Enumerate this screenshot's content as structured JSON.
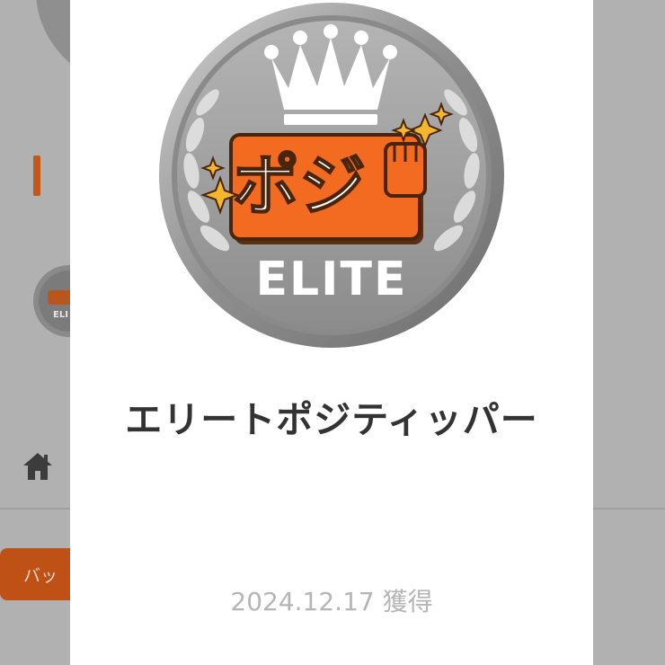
{
  "background": {
    "tab_button_label": "バッ",
    "home_icon": "home-icon"
  },
  "modal": {
    "badge": {
      "logo_text": "ポジ",
      "elite_text": "ELITE",
      "icons": [
        "crown-icon",
        "laurel-icon",
        "sparkle-icon",
        "fist-icon"
      ]
    },
    "title": "エリートポジティッパー",
    "date_acquired": "2024.12.17 獲得"
  },
  "colors": {
    "accent_orange": "#f26b21",
    "silver": "#9a9a9a",
    "overlay": "#b1b1b1"
  }
}
